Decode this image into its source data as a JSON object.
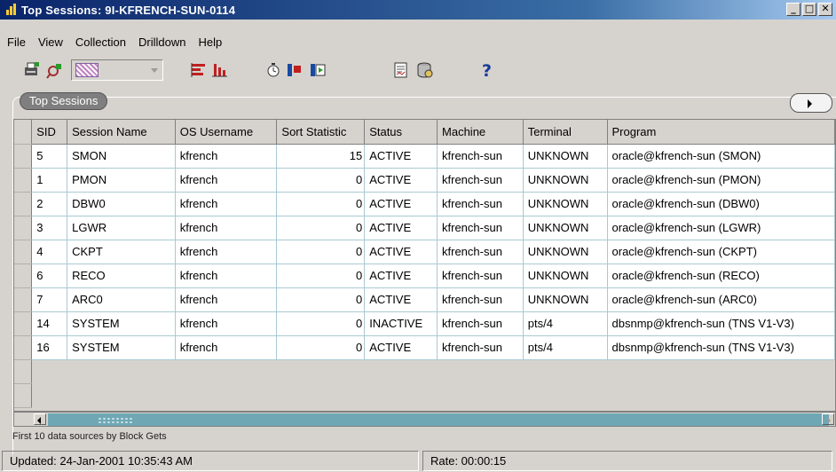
{
  "window": {
    "title": "Top Sessions: 9I-KFRENCH-SUN-0114",
    "controls": [
      "minimize",
      "maximize",
      "close"
    ]
  },
  "menu": [
    "File",
    "View",
    "Collection",
    "Drilldown",
    "Help"
  ],
  "toolbar": {
    "icons": [
      "print-icon",
      "find-icon",
      "chart-type-combo",
      "bar-chart-icon",
      "column-chart-icon",
      "timer-icon",
      "stop-icon",
      "play-icon",
      "report-icon",
      "database-icon",
      "help-icon"
    ]
  },
  "panel": {
    "tab_label": "Top Sessions"
  },
  "table": {
    "columns": [
      "SID",
      "Session Name",
      "OS Username",
      "Sort Statistic",
      "Status",
      "Machine",
      "Terminal",
      "Program"
    ],
    "rows": [
      [
        "5",
        "SMON",
        "kfrench",
        "15",
        "ACTIVE",
        "kfrench-sun",
        "UNKNOWN",
        "oracle@kfrench-sun (SMON)"
      ],
      [
        "1",
        "PMON",
        "kfrench",
        "0",
        "ACTIVE",
        "kfrench-sun",
        "UNKNOWN",
        "oracle@kfrench-sun (PMON)"
      ],
      [
        "2",
        "DBW0",
        "kfrench",
        "0",
        "ACTIVE",
        "kfrench-sun",
        "UNKNOWN",
        "oracle@kfrench-sun (DBW0)"
      ],
      [
        "3",
        "LGWR",
        "kfrench",
        "0",
        "ACTIVE",
        "kfrench-sun",
        "UNKNOWN",
        "oracle@kfrench-sun (LGWR)"
      ],
      [
        "4",
        "CKPT",
        "kfrench",
        "0",
        "ACTIVE",
        "kfrench-sun",
        "UNKNOWN",
        "oracle@kfrench-sun (CKPT)"
      ],
      [
        "6",
        "RECO",
        "kfrench",
        "0",
        "ACTIVE",
        "kfrench-sun",
        "UNKNOWN",
        "oracle@kfrench-sun (RECO)"
      ],
      [
        "7",
        "ARC0",
        "kfrench",
        "0",
        "ACTIVE",
        "kfrench-sun",
        "UNKNOWN",
        "oracle@kfrench-sun (ARC0)"
      ],
      [
        "14",
        "SYSTEM",
        "kfrench",
        "0",
        "INACTIVE",
        "kfrench-sun",
        "pts/4",
        "dbsnmp@kfrench-sun (TNS V1-V3)"
      ],
      [
        "16",
        "SYSTEM",
        "kfrench",
        "0",
        "ACTIVE",
        "kfrench-sun",
        "pts/4",
        "dbsnmp@kfrench-sun (TNS V1-V3)"
      ]
    ]
  },
  "footnote": "First 10 data sources by Block Gets",
  "status": {
    "updated": "Updated: 24-Jan-2001 10:35:43 AM",
    "rate": "Rate: 00:00:15"
  },
  "colors": {
    "title_start": "#0a246a",
    "title_end": "#a6caf0",
    "grid_line": "#a9c9d4",
    "scroll_thumb": "#6fa8b4",
    "face": "#d6d3ce"
  }
}
